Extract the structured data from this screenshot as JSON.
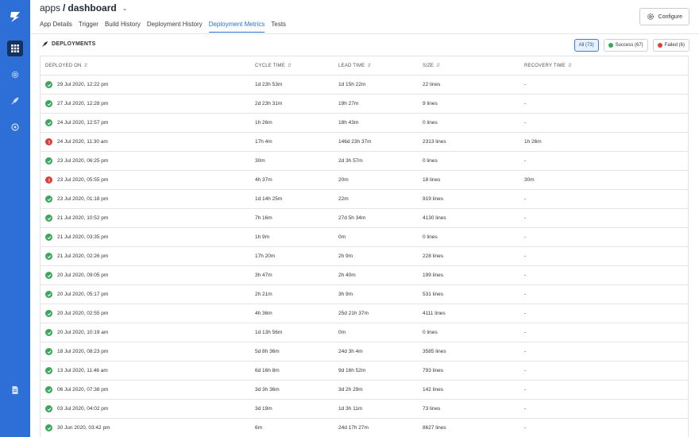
{
  "colors": {
    "brand": "#2d6fd6",
    "success": "#3aa85a",
    "failed": "#d9423a",
    "active_tab": "#2d6fd6"
  },
  "sidebar": {
    "logo": "logo-icon",
    "items": [
      {
        "icon": "apps-grid-icon",
        "active": true
      },
      {
        "icon": "gear-icon",
        "active": false
      },
      {
        "icon": "rocket-icon",
        "active": false
      },
      {
        "icon": "settings-icon",
        "active": false
      },
      {
        "icon": "document-icon",
        "active": false
      }
    ]
  },
  "header": {
    "org": "apps",
    "separator": "/",
    "app_name": "dashboard",
    "tabs": [
      {
        "label": "App Details",
        "active": false
      },
      {
        "label": "Trigger",
        "active": false
      },
      {
        "label": "Build History",
        "active": false
      },
      {
        "label": "Deployment History",
        "active": false
      },
      {
        "label": "Deployment Metrics",
        "active": true
      },
      {
        "label": "Tests",
        "active": false
      }
    ],
    "configure_label": "Configure"
  },
  "section": {
    "title": "DEPLOYMENTS"
  },
  "filters": {
    "all": "All (73)",
    "success": "Success (67)",
    "failed": "Failed (6)"
  },
  "table": {
    "headers": {
      "deployed_on": "DEPLOYED ON",
      "cycle_time": "CYCLE TIME",
      "lead_time": "LEAD TIME",
      "size": "SIZE",
      "recovery_time": "RECOVERY TIME"
    },
    "rows": [
      {
        "status": "success",
        "deployed_on": "29 Jul 2020, 12:22 pm",
        "cycle_time": "1d 23h 53m",
        "lead_time": "1d 15h 22m",
        "size": "22 lines",
        "recovery_time": "-"
      },
      {
        "status": "success",
        "deployed_on": "27 Jul 2020, 12:28 pm",
        "cycle_time": "2d 23h 31m",
        "lead_time": "19h 27m",
        "size": "9 lines",
        "recovery_time": "-"
      },
      {
        "status": "success",
        "deployed_on": "24 Jul 2020, 12:57 pm",
        "cycle_time": "1h 26m",
        "lead_time": "18h 43m",
        "size": "0 lines",
        "recovery_time": "-"
      },
      {
        "status": "failed",
        "deployed_on": "24 Jul 2020, 11:30 am",
        "cycle_time": "17h 4m",
        "lead_time": "146d 23h 37m",
        "size": "2313 lines",
        "recovery_time": "1h 26m"
      },
      {
        "status": "success",
        "deployed_on": "23 Jul 2020, 06:25 pm",
        "cycle_time": "30m",
        "lead_time": "2d 3h 57m",
        "size": "0 lines",
        "recovery_time": "-"
      },
      {
        "status": "failed",
        "deployed_on": "23 Jul 2020, 05:55 pm",
        "cycle_time": "4h 37m",
        "lead_time": "20m",
        "size": "18 lines",
        "recovery_time": "30m"
      },
      {
        "status": "success",
        "deployed_on": "23 Jul 2020, 01:18 pm",
        "cycle_time": "1d 14h 25m",
        "lead_time": "22m",
        "size": "919 lines",
        "recovery_time": "-"
      },
      {
        "status": "success",
        "deployed_on": "21 Jul 2020, 10:52 pm",
        "cycle_time": "7h 16m",
        "lead_time": "27d 5h 34m",
        "size": "4130 lines",
        "recovery_time": "-"
      },
      {
        "status": "success",
        "deployed_on": "21 Jul 2020, 03:35 pm",
        "cycle_time": "1h 9m",
        "lead_time": "0m",
        "size": "0 lines",
        "recovery_time": "-"
      },
      {
        "status": "success",
        "deployed_on": "21 Jul 2020, 02:26 pm",
        "cycle_time": "17h 20m",
        "lead_time": "2h 9m",
        "size": "228 lines",
        "recovery_time": "-"
      },
      {
        "status": "success",
        "deployed_on": "20 Jul 2020, 09:05 pm",
        "cycle_time": "3h 47m",
        "lead_time": "2h 40m",
        "size": "199 lines",
        "recovery_time": "-"
      },
      {
        "status": "success",
        "deployed_on": "20 Jul 2020, 05:17 pm",
        "cycle_time": "2h 21m",
        "lead_time": "3h 9m",
        "size": "531 lines",
        "recovery_time": "-"
      },
      {
        "status": "success",
        "deployed_on": "20 Jul 2020, 02:55 pm",
        "cycle_time": "4h 36m",
        "lead_time": "25d 21h 37m",
        "size": "4111 lines",
        "recovery_time": "-"
      },
      {
        "status": "success",
        "deployed_on": "20 Jul 2020, 10:19 am",
        "cycle_time": "1d 13h 56m",
        "lead_time": "0m",
        "size": "0 lines",
        "recovery_time": "-"
      },
      {
        "status": "success",
        "deployed_on": "18 Jul 2020, 08:23 pm",
        "cycle_time": "5d 8h 36m",
        "lead_time": "24d 3h 4m",
        "size": "3585 lines",
        "recovery_time": "-"
      },
      {
        "status": "success",
        "deployed_on": "13 Jul 2020, 11:46 am",
        "cycle_time": "6d 16h 8m",
        "lead_time": "9d 16h 52m",
        "size": "793 lines",
        "recovery_time": "-"
      },
      {
        "status": "success",
        "deployed_on": "06 Jul 2020, 07:38 pm",
        "cycle_time": "3d 3h 36m",
        "lead_time": "3d 2h 29m",
        "size": "142 lines",
        "recovery_time": "-"
      },
      {
        "status": "success",
        "deployed_on": "03 Jul 2020, 04:02 pm",
        "cycle_time": "3d 19m",
        "lead_time": "1d 3h 11m",
        "size": "73 lines",
        "recovery_time": "-"
      },
      {
        "status": "success",
        "deployed_on": "30 Jun 2020, 03:42 pm",
        "cycle_time": "6m",
        "lead_time": "24d 17h 27m",
        "size": "8627 lines",
        "recovery_time": "-"
      }
    ]
  }
}
